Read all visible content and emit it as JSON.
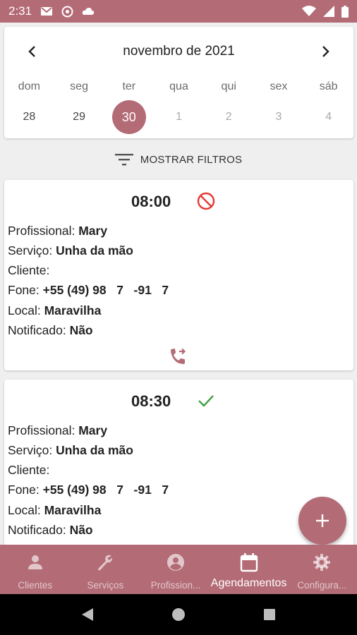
{
  "status_bar": {
    "time": "2:31",
    "icons_left": [
      "gmail-icon",
      "at-sign-icon",
      "cloud-icon"
    ],
    "icons_right": [
      "wifi-icon",
      "signal-icon",
      "battery-icon"
    ]
  },
  "calendar": {
    "title": "novembro de 2021",
    "prev_icon": "chevron-left-icon",
    "next_icon": "chevron-right-icon",
    "weekdays": [
      "dom",
      "seg",
      "ter",
      "qua",
      "qui",
      "sex",
      "sáb"
    ],
    "days": [
      "28",
      "29",
      "30",
      "1",
      "2",
      "3",
      "4"
    ],
    "selected_day": "30"
  },
  "filters": {
    "label": "MOSTRAR FILTROS",
    "icon": "filter-list-icon"
  },
  "appointments": [
    {
      "time": "08:00",
      "status_icon": "blocked-icon",
      "status_color": "#e53935",
      "professional_label": "Profissional:",
      "professional": "Mary",
      "service_label": "Serviço:",
      "service": "Unha da mão",
      "client_label": "Cliente:",
      "client": "",
      "phone_label": "Fone:",
      "phone": "+55 (49) 98   7   -91   7",
      "location_label": "Local:",
      "location": "Maravilha",
      "notified_label": "Notificado:",
      "notified": "Não",
      "action_icon": "phone-forwarded-icon"
    },
    {
      "time": "08:30",
      "status_icon": "check-icon",
      "status_color": "#43a047",
      "professional_label": "Profissional:",
      "professional": "Mary",
      "service_label": "Serviço:",
      "service": "Unha da mão",
      "client_label": "Cliente:",
      "client": "",
      "phone_label": "Fone:",
      "phone": "+55 (49) 98   7   -91   7",
      "location_label": "Local:",
      "location": "Maravilha",
      "notified_label": "Notificado:",
      "notified": "Não"
    }
  ],
  "fab": {
    "icon": "plus-icon"
  },
  "bottom_nav": [
    {
      "label": "Clientes",
      "icon": "person-icon",
      "active": false
    },
    {
      "label": "Serviços",
      "icon": "wrench-icon",
      "active": false
    },
    {
      "label": "Profission...",
      "icon": "account-circle-icon",
      "active": false
    },
    {
      "label": "Agendamentos",
      "icon": "calendar-icon",
      "active": true
    },
    {
      "label": "Configura...",
      "icon": "gear-icon",
      "active": false
    }
  ],
  "colors": {
    "accent": "#b36b76",
    "blocked": "#e53935",
    "confirmed": "#43a047",
    "background": "#efefef"
  }
}
